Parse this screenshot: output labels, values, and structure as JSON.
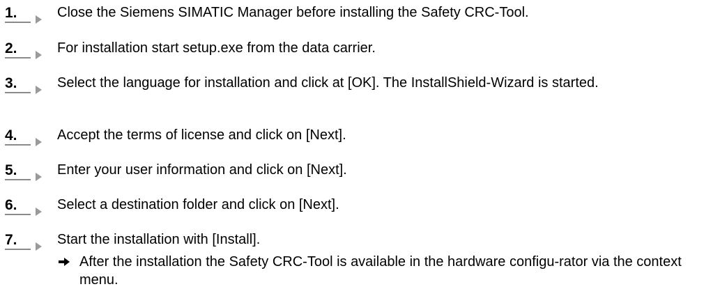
{
  "colors": {
    "text": "#000000",
    "step_number": "#000000",
    "marker_line": "#8a8a8a",
    "marker_triangle": "#9a9a9a",
    "result_arrow": "#000000"
  },
  "icons": {
    "step_marker": "triangle-right-icon",
    "result_marker": "arrow-right-icon"
  },
  "steps": [
    {
      "number": "1.",
      "text": "Close the Siemens SIMATIC Manager before installing the Safety CRC-Tool."
    },
    {
      "number": "2.",
      "text": "For installation start setup.exe from the data carrier."
    },
    {
      "number": "3.",
      "text": "Select the language for installation and click at [OK]. The InstallShield-Wizard is started."
    },
    {
      "number": "4.",
      "text": "Accept the terms of license and click on [Next]."
    },
    {
      "number": "5.",
      "text": "Enter your user information and click on [Next]."
    },
    {
      "number": "6.",
      "text": "Select a destination folder and click on [Next]."
    },
    {
      "number": "7.",
      "text": "Start the installation with [Install]."
    }
  ],
  "result": {
    "text": "After the installation the Safety CRC-Tool is available in the hardware configu-rator via the context menu."
  }
}
